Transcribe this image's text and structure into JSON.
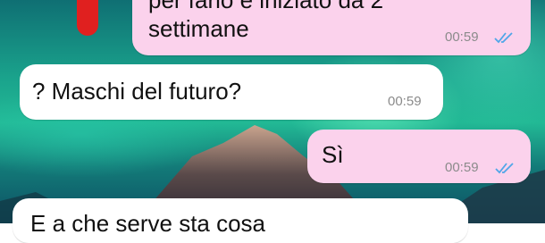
{
  "messages": [
    {
      "direction": "out",
      "text_line1": "per farlo è iniziato da 2",
      "text_line2": "settimane",
      "time": "00:59",
      "status": "read"
    },
    {
      "direction": "in",
      "text": "? Maschi del futuro?",
      "time": "00:59"
    },
    {
      "direction": "out",
      "text": "Sì",
      "time": "00:59",
      "status": "read"
    },
    {
      "direction": "in",
      "text": "E a che serve sta cosa"
    }
  ],
  "colors": {
    "outgoing_bubble": "#fbd2ec",
    "incoming_bubble": "#ffffff",
    "read_ticks": "#4fa6e8",
    "timestamp": "#8b8b8b"
  },
  "icons": [
    "double-check-read-icon"
  ]
}
